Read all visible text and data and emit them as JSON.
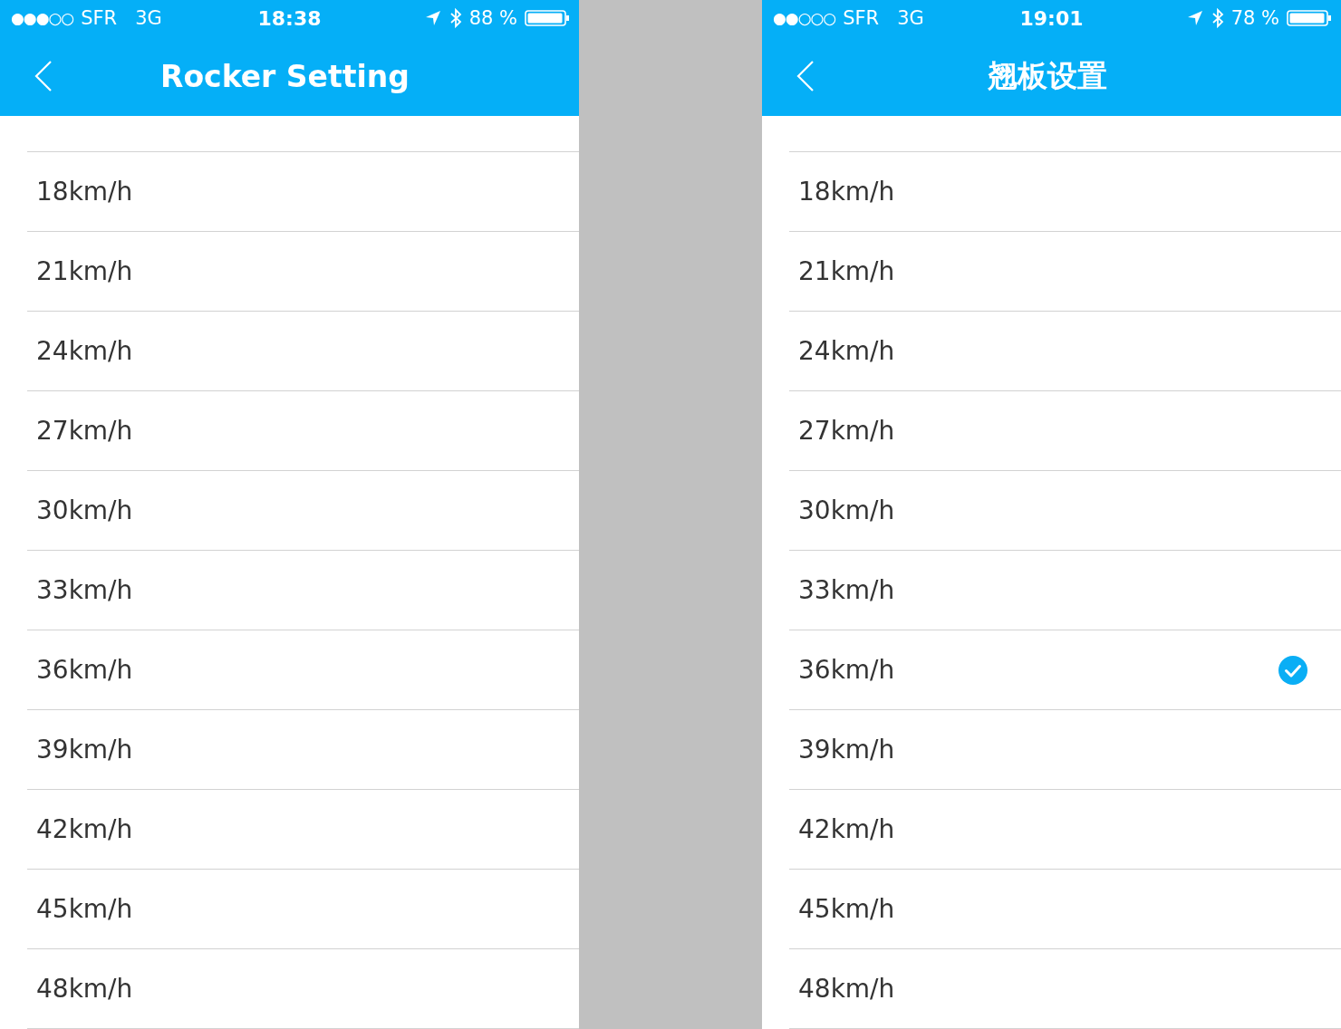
{
  "screens": [
    {
      "status_bar": {
        "signal": "●●●○○",
        "carrier": "SFR",
        "network": "3G",
        "time": "18:38",
        "battery": "88 %"
      },
      "title": "Rocker Setting",
      "rows": [
        {
          "label": "18km/h",
          "selected": false
        },
        {
          "label": "21km/h",
          "selected": false
        },
        {
          "label": "24km/h",
          "selected": false
        },
        {
          "label": "27km/h",
          "selected": false
        },
        {
          "label": "30km/h",
          "selected": false
        },
        {
          "label": "33km/h",
          "selected": false
        },
        {
          "label": "36km/h",
          "selected": false
        },
        {
          "label": "39km/h",
          "selected": false
        },
        {
          "label": "42km/h",
          "selected": false
        },
        {
          "label": "45km/h",
          "selected": false
        },
        {
          "label": "48km/h",
          "selected": false
        }
      ]
    },
    {
      "status_bar": {
        "signal": "●●○○○",
        "carrier": "SFR",
        "network": "3G",
        "time": "19:01",
        "battery": "78 %"
      },
      "title": "翘板设置",
      "rows": [
        {
          "label": "18km/h",
          "selected": false
        },
        {
          "label": "21km/h",
          "selected": false
        },
        {
          "label": "24km/h",
          "selected": false
        },
        {
          "label": "27km/h",
          "selected": false
        },
        {
          "label": "30km/h",
          "selected": false
        },
        {
          "label": "33km/h",
          "selected": false
        },
        {
          "label": "36km/h",
          "selected": true
        },
        {
          "label": "39km/h",
          "selected": false
        },
        {
          "label": "42km/h",
          "selected": false
        },
        {
          "label": "45km/h",
          "selected": false
        },
        {
          "label": "48km/h",
          "selected": false
        }
      ]
    }
  ]
}
